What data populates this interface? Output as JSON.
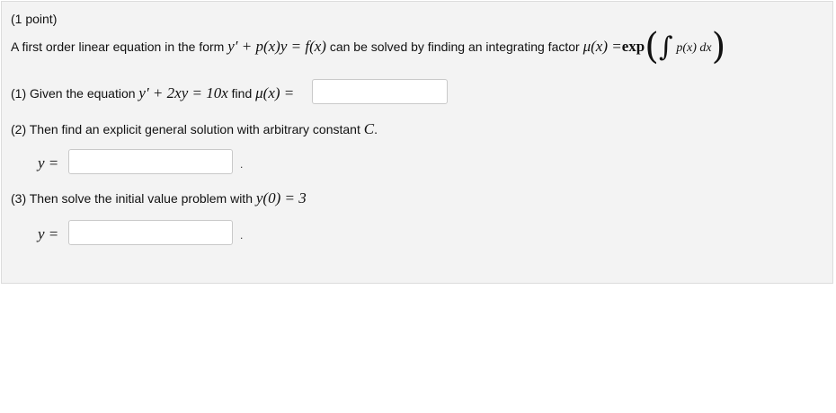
{
  "header": {
    "points": "(1 point)"
  },
  "intro": {
    "text_before": "A first order linear equation in the form",
    "eq_form": "y′ + p(x)y = f(x)",
    "text_middle": "can be solved by finding an integrating factor",
    "mu": "μ(x) =",
    "exp": "exp",
    "integrand": "p(x) dx"
  },
  "part1": {
    "text": "(1) Given the equation",
    "equation": "y′ + 2xy = 10x",
    "find": "find",
    "mu_eq": "μ(x) =",
    "answer": ""
  },
  "part2": {
    "text": "(2) Then find an explicit general solution with arbitrary constant",
    "constant": "C",
    "period": ".",
    "y_label": "y =",
    "answer": "",
    "trailing": "."
  },
  "part3": {
    "text": "(3) Then solve the initial value problem with",
    "condition": "y(0) = 3",
    "y_label": "y =",
    "answer": "",
    "trailing": "."
  }
}
